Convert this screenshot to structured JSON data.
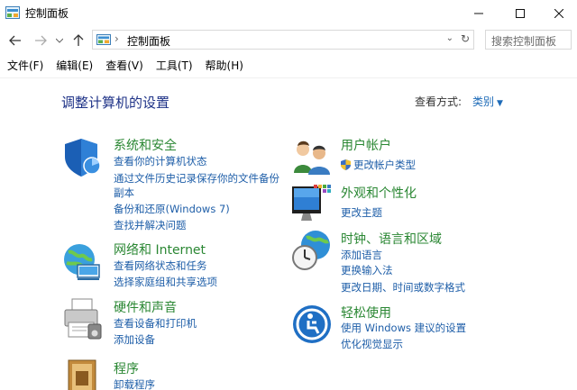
{
  "window": {
    "title": "控制面板",
    "controls": {
      "minimize": "—",
      "maximize": "☐",
      "close": "✕"
    }
  },
  "nav": {
    "back": "←",
    "forward": "→",
    "recent": "⌄",
    "up": "↑",
    "address_separator": "›",
    "address_crumb": "控制面板",
    "address_dropdown": "⌄",
    "refresh": "↻",
    "search_placeholder": "搜索控制面板"
  },
  "menu": [
    "文件(F)",
    "编辑(E)",
    "查看(V)",
    "工具(T)",
    "帮助(H)"
  ],
  "content": {
    "heading": "调整计算机的设置",
    "view_by_label": "查看方式:",
    "view_by_value": "类别"
  },
  "categories": [
    {
      "title": "系统和安全",
      "icon": "shield-icon",
      "links": [
        "查看你的计算机状态",
        "通过文件历史记录保存你的文件备份",
        "副本",
        "备份和还原(Windows 7)",
        "查找并解决问题"
      ]
    },
    {
      "title": "网络和 Internet",
      "icon": "network-globe-icon",
      "links": [
        "查看网络状态和任务",
        "选择家庭组和共享选项"
      ]
    },
    {
      "title": "硬件和声音",
      "icon": "printer-icon",
      "links": [
        "查看设备和打印机",
        "添加设备"
      ]
    },
    {
      "title": "程序",
      "icon": "programs-icon",
      "links": [
        "卸载程序"
      ]
    },
    {
      "title": "用户帐户",
      "icon": "users-icon",
      "links": [
        "更改帐户类型"
      ]
    },
    {
      "title": "外观和个性化",
      "icon": "display-icon",
      "links": [
        "更改主题"
      ]
    },
    {
      "title": "时钟、语言和区域",
      "icon": "clock-globe-icon",
      "links": [
        "添加语言",
        "更换输入法",
        "更改日期、时间或数字格式"
      ]
    },
    {
      "title": "轻松使用",
      "icon": "accessibility-icon",
      "links": [
        "使用 Windows 建议的设置",
        "优化视觉显示"
      ]
    }
  ],
  "colors": {
    "category_title": "#2a8733",
    "link": "#1e5ea8",
    "heading": "#1e3287"
  }
}
